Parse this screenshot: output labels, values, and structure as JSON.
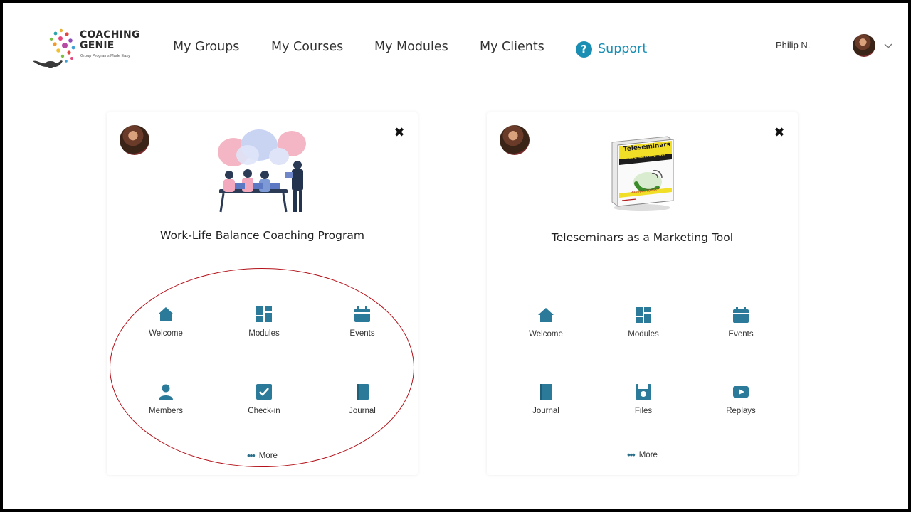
{
  "header": {
    "logo": {
      "title_line1": "COACHING",
      "title_line2": "GENIE",
      "tagline": "Group Programs Made Easy"
    },
    "nav": [
      "My Groups",
      "My Courses",
      "My Modules",
      "My Clients"
    ],
    "support": {
      "icon": "help-circle-icon",
      "label": "Support"
    },
    "user": {
      "name": "Philip N."
    }
  },
  "colors": {
    "accent": "#1a8fb3",
    "icon": "#2b7a99",
    "annotation": "#b3121a"
  },
  "cards": [
    {
      "title": "Work-Life Balance Coaching Program",
      "tiles": [
        {
          "label": "Welcome",
          "icon": "home-icon"
        },
        {
          "label": "Modules",
          "icon": "grid-icon"
        },
        {
          "label": "Events",
          "icon": "calendar-icon"
        },
        {
          "label": "Members",
          "icon": "person-icon"
        },
        {
          "label": "Check-in",
          "icon": "checkbox-icon"
        },
        {
          "label": "Journal",
          "icon": "book-icon"
        }
      ],
      "more_label": "More"
    },
    {
      "title": "Teleseminars as a Marketing Tool",
      "book_cover": {
        "line1": "Teleseminars",
        "line2": "as a Marketing Tool",
        "author": "MIRANA LITURSKY"
      },
      "tiles": [
        {
          "label": "Welcome",
          "icon": "home-icon"
        },
        {
          "label": "Modules",
          "icon": "grid-icon"
        },
        {
          "label": "Events",
          "icon": "calendar-icon"
        },
        {
          "label": "Journal",
          "icon": "book-icon"
        },
        {
          "label": "Files",
          "icon": "floppy-icon"
        },
        {
          "label": "Replays",
          "icon": "play-icon"
        }
      ],
      "more_label": "More"
    }
  ]
}
